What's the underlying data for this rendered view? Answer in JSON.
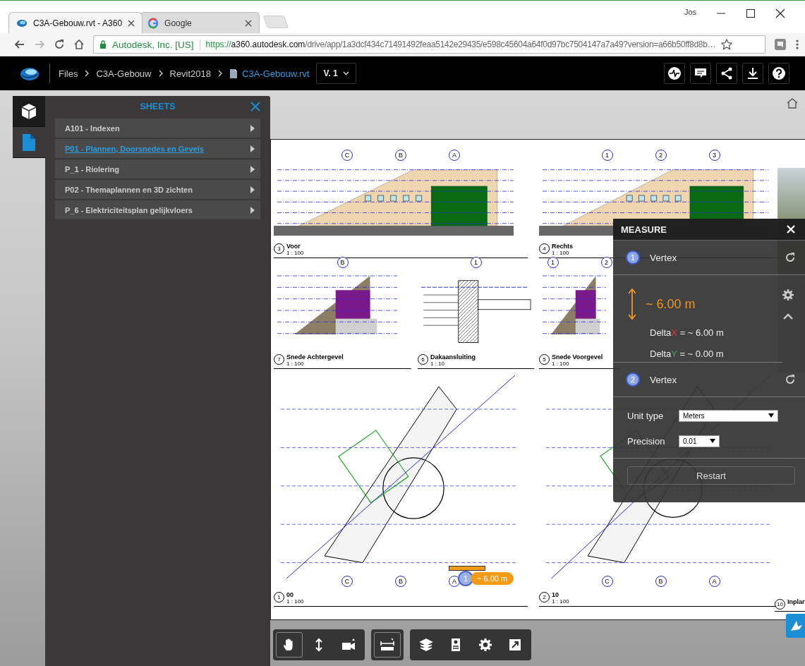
{
  "browser": {
    "tabs": [
      {
        "title": "C3A-Gebouw.rvt - A360",
        "kind": "a360",
        "selected": true
      },
      {
        "title": "Google",
        "kind": "google",
        "selected": false
      }
    ],
    "profile": "Jos",
    "address": {
      "site": "Autodesk, Inc. [US]",
      "scheme": "https://",
      "host": "a360.autodesk.com",
      "path": "/drive/app/1a3dcf434c71491492feaa5142e29435/e598c45604a64f0d97bc7504147a7a49?version=a66b50ff8d8b…"
    }
  },
  "header": {
    "breadcrumbs": [
      "Files",
      "C3A-Gebouw",
      "Revit2018"
    ],
    "file": "C3A-Gebouw.rvt",
    "version": "V. 1",
    "actions": [
      {
        "kind": "activity"
      },
      {
        "kind": "comment"
      },
      {
        "kind": "share"
      },
      {
        "kind": "download"
      },
      {
        "kind": "help"
      }
    ]
  },
  "side_tabs": [
    {
      "kind": "model",
      "selected": false
    },
    {
      "kind": "sheets",
      "selected": true
    }
  ],
  "sheets_panel": {
    "title": "SHEETS",
    "items": [
      {
        "label": "A101 - Indexen",
        "selected": false
      },
      {
        "label": "P01 - Plannen, Doorsnedes en Gevels",
        "selected": true
      },
      {
        "label": "P_1 - Riolering",
        "selected": false
      },
      {
        "label": "P02 - Themaplannen en 3D zichten",
        "selected": false
      },
      {
        "label": "P_6 - Elektriciteitsplan gelijkvloers",
        "selected": false
      }
    ]
  },
  "sheet": {
    "views": [
      {
        "kind": "elevation",
        "number": "3",
        "title": "Voor",
        "scale": "1 : 100",
        "grid": [
          "C",
          "B",
          "A"
        ]
      },
      {
        "kind": "elevation",
        "number": "4",
        "title": "Rechts",
        "scale": "1 : 100",
        "grid": [
          "1",
          "2",
          "3"
        ]
      },
      {
        "kind": "section",
        "number": "7",
        "title": "Snede Achtergevel",
        "scale": "1 : 100",
        "grid": [
          "B"
        ]
      },
      {
        "kind": "detail",
        "number": "6",
        "title": "Dakaansluiting",
        "scale": "1 : 10",
        "grid": [
          "1"
        ]
      },
      {
        "kind": "section",
        "number": "5",
        "title": "Snede Voorgevel",
        "scale": "1 : 100",
        "grid": [
          "1",
          "2"
        ]
      },
      {
        "kind": "plan",
        "number": "1",
        "title": "00",
        "scale": "1 : 100",
        "grid": [
          "C",
          "B",
          "A"
        ]
      },
      {
        "kind": "plan",
        "number": "2",
        "title": "10",
        "scale": "1 : 100",
        "grid": [
          "C",
          "B",
          "A"
        ]
      },
      {
        "kind": "label",
        "number": "10",
        "title": "Inplar"
      }
    ],
    "marker": {
      "number": "1",
      "label": "~ 6.00 m"
    }
  },
  "measure": {
    "title": "MEASURE",
    "points": [
      {
        "number": "1",
        "label": "Vertex"
      },
      {
        "number": "2",
        "label": "Vertex"
      }
    ],
    "distance": "~ 6.00 m",
    "deltas": [
      {
        "prefix": "Delta",
        "axis": "X",
        "value": " = ~ 6.00 m",
        "color": "#e03a3a"
      },
      {
        "prefix": "Delta",
        "axis": "Y",
        "value": " = ~ 0.00 m",
        "color": "#3aa64a"
      }
    ],
    "unit_type": {
      "label": "Unit type",
      "value": "Meters"
    },
    "precision": {
      "label": "Precision",
      "value": "0.01"
    },
    "restart": "Restart"
  },
  "toolbar": [
    [
      {
        "kind": "pan",
        "selected": true
      },
      {
        "kind": "zoom",
        "selected": false
      },
      {
        "kind": "camera",
        "selected": false
      }
    ],
    [
      {
        "kind": "measure",
        "selected": true
      }
    ],
    [
      {
        "kind": "layers",
        "selected": false
      },
      {
        "kind": "properties",
        "selected": false
      },
      {
        "kind": "settings",
        "selected": false
      },
      {
        "kind": "fullscreen",
        "selected": false
      }
    ]
  ]
}
